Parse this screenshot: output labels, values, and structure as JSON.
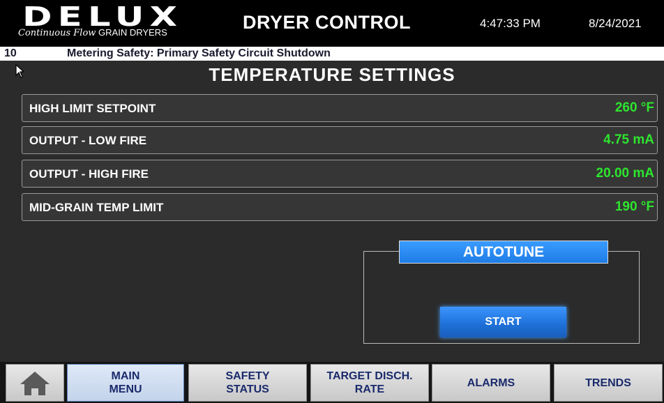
{
  "header": {
    "logo_mark": "DELUX",
    "logo_sub_script": "Continuous Flow",
    "logo_sub_plain": "GRAIN DRYERS",
    "title": "DRYER CONTROL",
    "time": "4:47:33 PM",
    "date": "8/24/2021"
  },
  "alarm": {
    "code": "10",
    "message": "Metering Safety: Primary Safety Circuit Shutdown"
  },
  "page": {
    "title": "TEMPERATURE SETTINGS"
  },
  "settings": [
    {
      "label": "HIGH LIMIT SETPOINT",
      "value": "260 °F"
    },
    {
      "label": "OUTPUT - LOW FIRE",
      "value": "4.75 mA"
    },
    {
      "label": "OUTPUT - HIGH FIRE",
      "value": "20.00 mA"
    },
    {
      "label": "MID-GRAIN TEMP LIMIT",
      "value": "190 °F"
    }
  ],
  "autotune": {
    "title": "AUTOTUNE",
    "start_label": "START"
  },
  "nav": {
    "home_icon": "home-icon",
    "buttons": [
      {
        "line1": "MAIN",
        "line2": "MENU"
      },
      {
        "line1": "SAFETY",
        "line2": "STATUS"
      },
      {
        "line1": "TARGET DISCH.",
        "line2": "RATE"
      },
      {
        "line1": "ALARMS",
        "line2": ""
      },
      {
        "line1": "TRENDS",
        "line2": ""
      }
    ]
  },
  "colors": {
    "value_green": "#2ee52e",
    "accent_blue": "#1f7de6",
    "nav_text": "#1a2a6b",
    "background": "#2b2b2b"
  }
}
